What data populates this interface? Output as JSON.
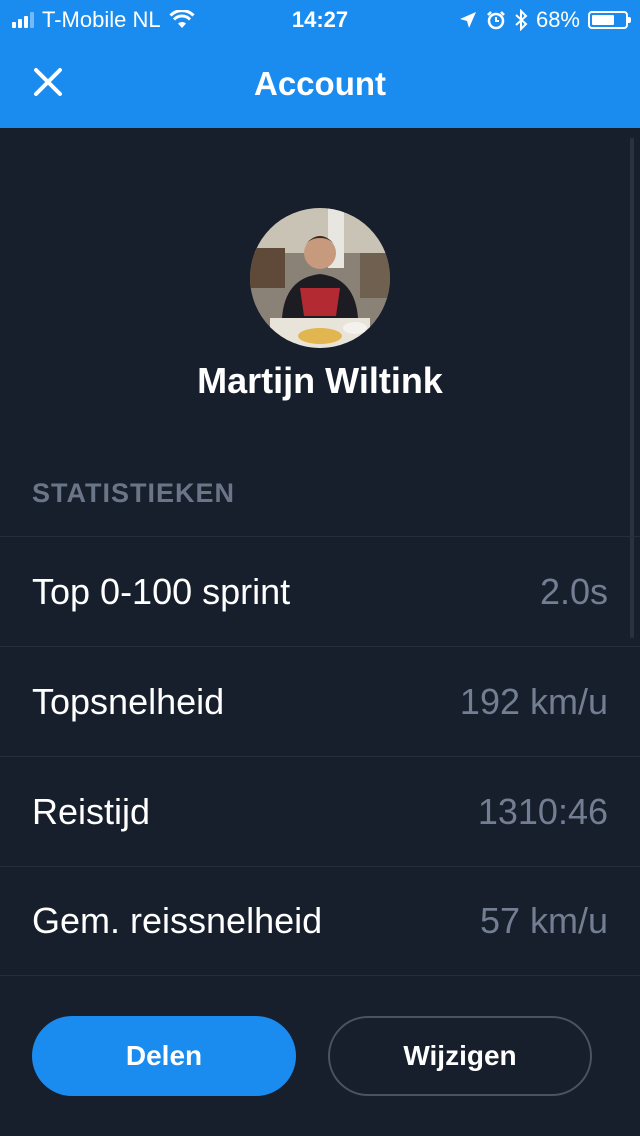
{
  "status_bar": {
    "carrier": "T-Mobile NL",
    "time": "14:27",
    "battery_percent": "68%",
    "battery_level": 0.68,
    "icons": [
      "signal-icon",
      "wifi-icon",
      "location-icon",
      "alarm-icon",
      "bluetooth-icon",
      "battery-icon"
    ]
  },
  "header": {
    "title": "Account",
    "close_icon": "close-icon"
  },
  "profile": {
    "name": "Martijn Wiltink"
  },
  "stats": {
    "section_title": "STATISTIEKEN",
    "rows": [
      {
        "label": "Top 0-100 sprint",
        "value": "2.0s"
      },
      {
        "label": "Topsnelheid",
        "value": "192 km/u"
      },
      {
        "label": "Reistijd",
        "value": "1310:46"
      },
      {
        "label": "Gem. reissnelheid",
        "value": "57 km/u"
      }
    ]
  },
  "actions": {
    "share_label": "Delen",
    "edit_label": "Wijzigen"
  },
  "colors": {
    "accent": "#1b8cef",
    "background": "#181f2c",
    "muted_text": "#737e92"
  }
}
